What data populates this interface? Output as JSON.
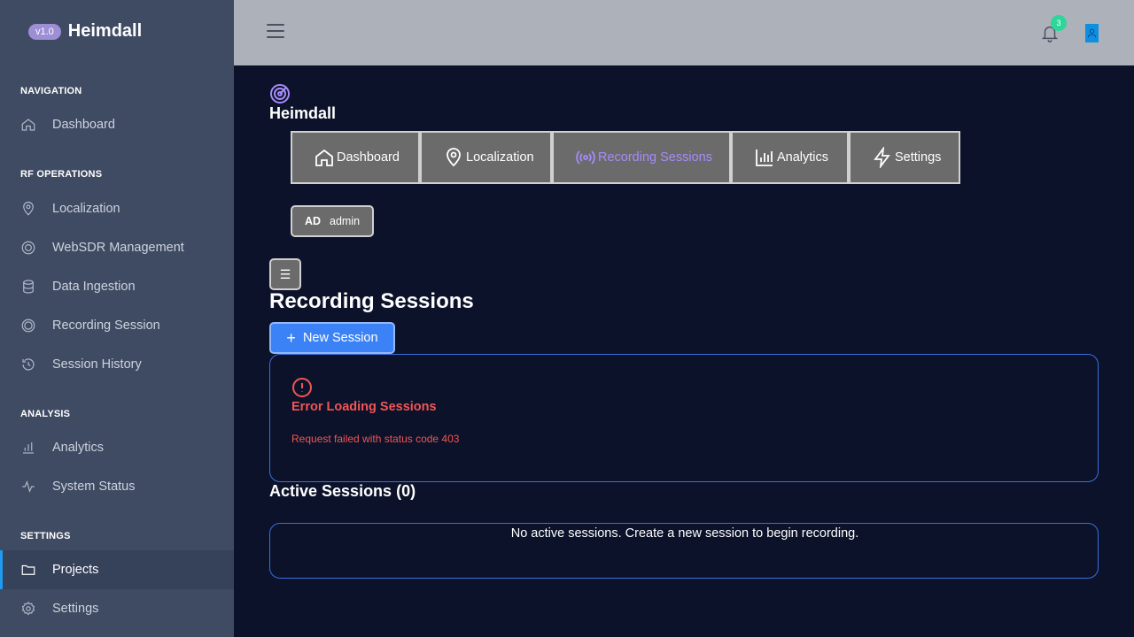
{
  "app": {
    "version": "v1.0",
    "name": "Heimdall"
  },
  "sidebar": {
    "sections": [
      {
        "label": "NAVIGATION",
        "items": [
          {
            "label": "Dashboard",
            "icon": "home-icon"
          }
        ]
      },
      {
        "label": "RF OPERATIONS",
        "items": [
          {
            "label": "Localization",
            "icon": "map-pin-icon"
          },
          {
            "label": "WebSDR Management",
            "icon": "target-icon"
          },
          {
            "label": "Data Ingestion",
            "icon": "database-icon"
          },
          {
            "label": "Recording Session",
            "icon": "record-icon"
          },
          {
            "label": "Session History",
            "icon": "history-icon"
          }
        ]
      },
      {
        "label": "ANALYSIS",
        "items": [
          {
            "label": "Analytics",
            "icon": "bar-chart-icon"
          },
          {
            "label": "System Status",
            "icon": "activity-icon"
          }
        ]
      },
      {
        "label": "SETTINGS",
        "items": [
          {
            "label": "Projects",
            "icon": "folder-icon",
            "active": true
          },
          {
            "label": "Settings",
            "icon": "gear-icon"
          }
        ]
      }
    ]
  },
  "topbar": {
    "notification_count": "3"
  },
  "main": {
    "brand": "Heimdall",
    "tabs": [
      {
        "label": "Dashboard",
        "icon": "home-icon"
      },
      {
        "label": "Localization",
        "icon": "map-pin-icon"
      },
      {
        "label": "Recording Sessions",
        "icon": "radio-icon",
        "active": true
      },
      {
        "label": "Analytics",
        "icon": "bar-chart-icon"
      },
      {
        "label": "Settings",
        "icon": "zap-icon"
      }
    ],
    "user": {
      "initials": "AD",
      "name": "admin"
    },
    "menu_glyph": "☰",
    "page_title": "Recording Sessions",
    "new_session_label": "New Session",
    "error": {
      "title": "Error Loading Sessions",
      "message": "Request failed with status code 403"
    },
    "active_sessions_title": "Active Sessions (0)",
    "empty_message": "No active sessions. Create a new session to begin recording."
  },
  "colors": {
    "accent": "#a78bfa",
    "primary": "#3b82f6",
    "error": "#f25555",
    "sidebar_bg": "#3f4b62",
    "main_bg": "#0b1229"
  }
}
